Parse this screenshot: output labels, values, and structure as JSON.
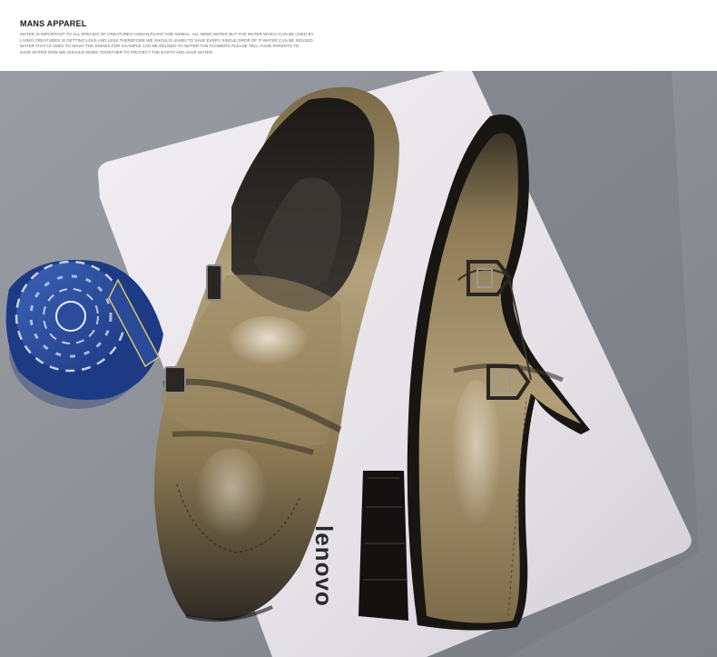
{
  "header": {
    "title": "MANS APPAREL",
    "body_lines": [
      "WATER IS IMPORTANT TO ALL SPECIES OF CREATURES HUMAN,PLANT AND ANIMAL. ALL NEED WATER BUT THE WATER WHICH CAN BE USED BY",
      "LIVING CREATURES IS GETTING LESS AND LESS THEREFORE WE SHOULD LEARN TO SAVE EVERY SINGLE DROP OF IT WATER CAN BE REUSED",
      "WATER THAT IS USED TO WASH THE DISHES FOR EXAMPLE CAN BE REUSED TO WATER THE FLOWERS PLEASE TELL YOUR PARENTS TO",
      "SAVE WATER NOW WE SHOULD WORK TOGETHER TO PROTECT THE EARTH AND SAVE WATER"
    ]
  },
  "photo": {
    "laptop_brand": "lenovo",
    "colors": {
      "backdrop": "#8e9298",
      "laptop": "#e9e7ec",
      "leather": "#8c7a54",
      "leather_dark": "#2e2a22",
      "sole": "#161412",
      "tie": "#2d4fa2"
    },
    "icons": [
      "necktie-icon",
      "buckle-icon"
    ]
  }
}
